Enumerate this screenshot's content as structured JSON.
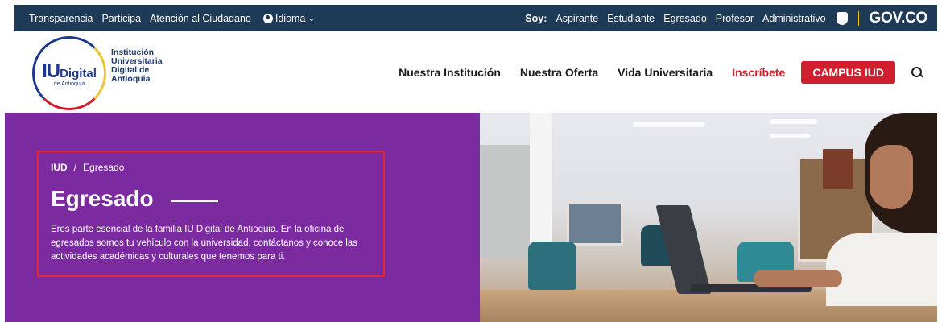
{
  "topbar": {
    "links": [
      "Transparencia",
      "Participa",
      "Atención al Ciudadano"
    ],
    "language_label": "Idioma",
    "soy_label": "Soy:",
    "audience_links": [
      "Aspirante",
      "Estudiante",
      "Egresado",
      "Profesor",
      "Administrativo"
    ],
    "gov_label": "GOV.CO"
  },
  "header": {
    "logo_mark": "IU",
    "logo_word": "Digital",
    "logo_sub": "de Antioquia",
    "logo_text": [
      "Institución",
      "Universitaria",
      "Digital de",
      "Antioquia"
    ],
    "nav": [
      "Nuestra Institución",
      "Nuestra Oferta",
      "Vida Universitaria"
    ],
    "cta_link": "Inscríbete",
    "campus_button": "CAMPUS IUD"
  },
  "hero": {
    "breadcrumb_home": "IUD",
    "breadcrumb_separator": "/",
    "breadcrumb_current": "Egresado",
    "title": "Egresado",
    "description": "Eres parte esencial de la familia IU Digital de Antioquia. En la oficina de egresados somos tu vehículo con la universidad, contáctanos y conoce las actividades académicas y culturales que tenemos para ti."
  },
  "colors": {
    "topbar_bg": "#1e3a56",
    "hero_purple": "#7b2aa0",
    "accent_red": "#d11f2e",
    "highlight_border": "#e2262b"
  },
  "icons": [
    "globe-icon",
    "chevron-down-icon",
    "gov-shield-icon",
    "search-icon"
  ]
}
